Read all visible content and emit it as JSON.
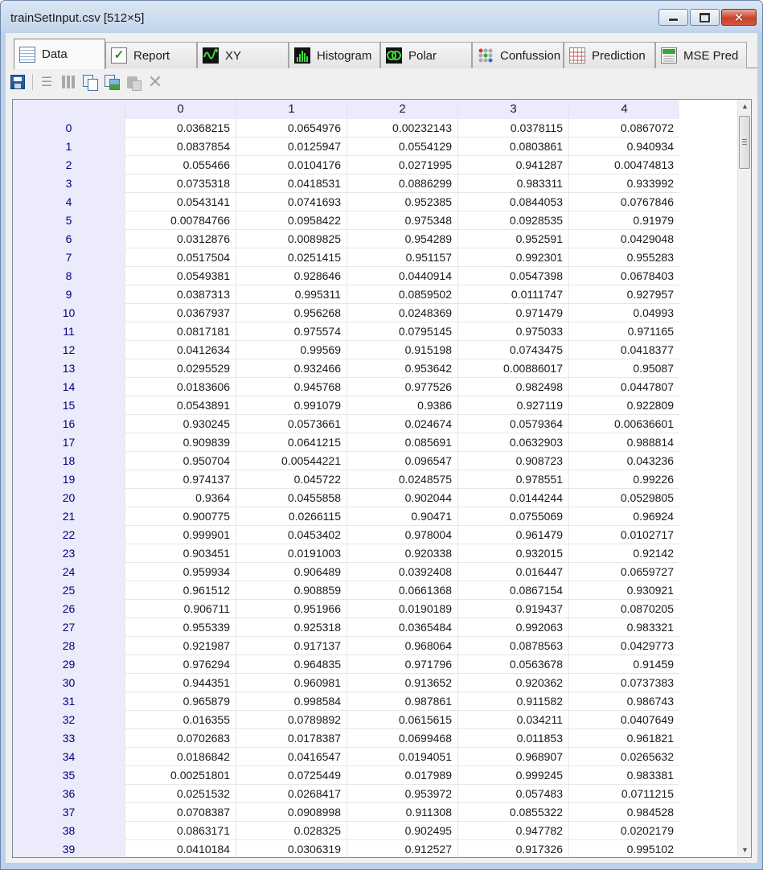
{
  "window": {
    "title": "trainSetInput.csv [512×5]"
  },
  "tabs": [
    {
      "label": "Data",
      "icon": "data-table-icon",
      "active": true
    },
    {
      "label": "Report",
      "icon": "report-check-icon"
    },
    {
      "label": "XY",
      "icon": "xy-wave-icon"
    },
    {
      "label": "Histogram",
      "icon": "histogram-icon"
    },
    {
      "label": "Polar",
      "icon": "polar-icon"
    },
    {
      "label": "Confussion",
      "icon": "confusion-dots-icon"
    },
    {
      "label": "Prediction",
      "icon": "prediction-grid-icon"
    },
    {
      "label": "MSE Pred",
      "icon": "mse-pred-icon"
    }
  ],
  "toolbar": [
    {
      "icon": "save-icon",
      "enabled": true
    },
    {
      "icon": "delete-rows-icon",
      "enabled": false
    },
    {
      "icon": "delete-columns-icon",
      "enabled": false
    },
    {
      "icon": "copy-icon",
      "enabled": true
    },
    {
      "icon": "copy-image-icon",
      "enabled": true
    },
    {
      "icon": "paste-icon",
      "enabled": false
    },
    {
      "icon": "clear-icon",
      "enabled": false
    }
  ],
  "grid": {
    "columns": [
      "0",
      "1",
      "2",
      "3",
      "4"
    ],
    "rows": [
      {
        "index": "0",
        "values": [
          "0.0368215",
          "0.0654976",
          "0.00232143",
          "0.0378115",
          "0.0867072"
        ]
      },
      {
        "index": "1",
        "values": [
          "0.0837854",
          "0.0125947",
          "0.0554129",
          "0.0803861",
          "0.940934"
        ]
      },
      {
        "index": "2",
        "values": [
          "0.055466",
          "0.0104176",
          "0.0271995",
          "0.941287",
          "0.00474813"
        ]
      },
      {
        "index": "3",
        "values": [
          "0.0735318",
          "0.0418531",
          "0.0886299",
          "0.983311",
          "0.933992"
        ]
      },
      {
        "index": "4",
        "values": [
          "0.0543141",
          "0.0741693",
          "0.952385",
          "0.0844053",
          "0.0767846"
        ]
      },
      {
        "index": "5",
        "values": [
          "0.00784766",
          "0.0958422",
          "0.975348",
          "0.0928535",
          "0.91979"
        ]
      },
      {
        "index": "6",
        "values": [
          "0.0312876",
          "0.0089825",
          "0.954289",
          "0.952591",
          "0.0429048"
        ]
      },
      {
        "index": "7",
        "values": [
          "0.0517504",
          "0.0251415",
          "0.951157",
          "0.992301",
          "0.955283"
        ]
      },
      {
        "index": "8",
        "values": [
          "0.0549381",
          "0.928646",
          "0.0440914",
          "0.0547398",
          "0.0678403"
        ]
      },
      {
        "index": "9",
        "values": [
          "0.0387313",
          "0.995311",
          "0.0859502",
          "0.0111747",
          "0.927957"
        ]
      },
      {
        "index": "10",
        "values": [
          "0.0367937",
          "0.956268",
          "0.0248369",
          "0.971479",
          "0.04993"
        ]
      },
      {
        "index": "11",
        "values": [
          "0.0817181",
          "0.975574",
          "0.0795145",
          "0.975033",
          "0.971165"
        ]
      },
      {
        "index": "12",
        "values": [
          "0.0412634",
          "0.99569",
          "0.915198",
          "0.0743475",
          "0.0418377"
        ]
      },
      {
        "index": "13",
        "values": [
          "0.0295529",
          "0.932466",
          "0.953642",
          "0.00886017",
          "0.95087"
        ]
      },
      {
        "index": "14",
        "values": [
          "0.0183606",
          "0.945768",
          "0.977526",
          "0.982498",
          "0.0447807"
        ]
      },
      {
        "index": "15",
        "values": [
          "0.0543891",
          "0.991079",
          "0.9386",
          "0.927119",
          "0.922809"
        ]
      },
      {
        "index": "16",
        "values": [
          "0.930245",
          "0.0573661",
          "0.024674",
          "0.0579364",
          "0.00636601"
        ]
      },
      {
        "index": "17",
        "values": [
          "0.909839",
          "0.0641215",
          "0.085691",
          "0.0632903",
          "0.988814"
        ]
      },
      {
        "index": "18",
        "values": [
          "0.950704",
          "0.00544221",
          "0.096547",
          "0.908723",
          "0.043236"
        ]
      },
      {
        "index": "19",
        "values": [
          "0.974137",
          "0.045722",
          "0.0248575",
          "0.978551",
          "0.99226"
        ]
      },
      {
        "index": "20",
        "values": [
          "0.9364",
          "0.0455858",
          "0.902044",
          "0.0144244",
          "0.0529805"
        ]
      },
      {
        "index": "21",
        "values": [
          "0.900775",
          "0.0266115",
          "0.90471",
          "0.0755069",
          "0.96924"
        ]
      },
      {
        "index": "22",
        "values": [
          "0.999901",
          "0.0453402",
          "0.978004",
          "0.961479",
          "0.0102717"
        ]
      },
      {
        "index": "23",
        "values": [
          "0.903451",
          "0.0191003",
          "0.920338",
          "0.932015",
          "0.92142"
        ]
      },
      {
        "index": "24",
        "values": [
          "0.959934",
          "0.906489",
          "0.0392408",
          "0.016447",
          "0.0659727"
        ]
      },
      {
        "index": "25",
        "values": [
          "0.961512",
          "0.908859",
          "0.0661368",
          "0.0867154",
          "0.930921"
        ]
      },
      {
        "index": "26",
        "values": [
          "0.906711",
          "0.951966",
          "0.0190189",
          "0.919437",
          "0.0870205"
        ]
      },
      {
        "index": "27",
        "values": [
          "0.955339",
          "0.925318",
          "0.0365484",
          "0.992063",
          "0.983321"
        ]
      },
      {
        "index": "28",
        "values": [
          "0.921987",
          "0.917137",
          "0.968064",
          "0.0878563",
          "0.0429773"
        ]
      },
      {
        "index": "29",
        "values": [
          "0.976294",
          "0.964835",
          "0.971796",
          "0.0563678",
          "0.91459"
        ]
      },
      {
        "index": "30",
        "values": [
          "0.944351",
          "0.960981",
          "0.913652",
          "0.920362",
          "0.0737383"
        ]
      },
      {
        "index": "31",
        "values": [
          "0.965879",
          "0.998584",
          "0.987861",
          "0.911582",
          "0.986743"
        ]
      },
      {
        "index": "32",
        "values": [
          "0.016355",
          "0.0789892",
          "0.0615615",
          "0.034211",
          "0.0407649"
        ]
      },
      {
        "index": "33",
        "values": [
          "0.0702683",
          "0.0178387",
          "0.0699468",
          "0.011853",
          "0.961821"
        ]
      },
      {
        "index": "34",
        "values": [
          "0.0186842",
          "0.0416547",
          "0.0194051",
          "0.968907",
          "0.0265632"
        ]
      },
      {
        "index": "35",
        "values": [
          "0.00251801",
          "0.0725449",
          "0.017989",
          "0.999245",
          "0.983381"
        ]
      },
      {
        "index": "36",
        "values": [
          "0.0251532",
          "0.0268417",
          "0.953972",
          "0.057483",
          "0.0711215"
        ]
      },
      {
        "index": "37",
        "values": [
          "0.0708387",
          "0.0908998",
          "0.911308",
          "0.0855322",
          "0.984528"
        ]
      },
      {
        "index": "38",
        "values": [
          "0.0863171",
          "0.028325",
          "0.902495",
          "0.947782",
          "0.0202179"
        ]
      },
      {
        "index": "39",
        "values": [
          "0.0410184",
          "0.0306319",
          "0.912527",
          "0.917326",
          "0.995102"
        ]
      }
    ]
  }
}
